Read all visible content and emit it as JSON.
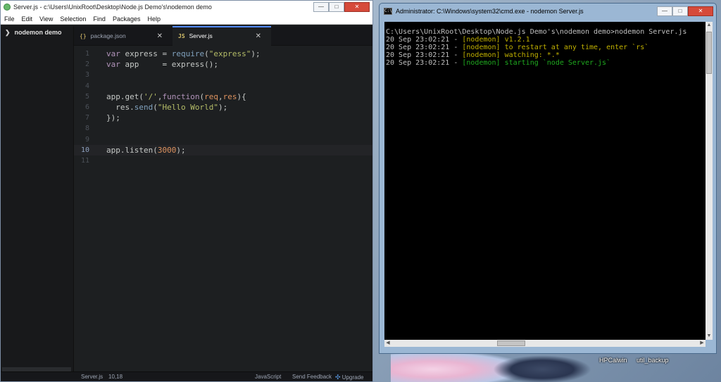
{
  "desktop": {
    "icons": [
      "HPCalwin",
      "util_backup"
    ]
  },
  "atom": {
    "title": "Server.js - c:\\Users\\UnixRoot\\Desktop\\Node.js Demo's\\nodemon demo",
    "window_buttons": {
      "minimize": "—",
      "maximize": "□",
      "close": "✕"
    },
    "menu": [
      "File",
      "Edit",
      "View",
      "Selection",
      "Find",
      "Packages",
      "Help"
    ],
    "tree_root": "nodemon demo",
    "tabs": [
      {
        "label": "package.json",
        "icon": "{}",
        "active": false
      },
      {
        "label": "Server.js",
        "icon": "JS",
        "active": true
      }
    ],
    "lines": [
      {
        "n": "1",
        "tokens": [
          [
            "kw",
            "var"
          ],
          [
            "par",
            " express "
          ],
          [
            "par",
            "= "
          ],
          [
            "fn",
            "require"
          ],
          [
            "par",
            "("
          ],
          [
            "str",
            "\"express\""
          ],
          [
            "par",
            ");"
          ]
        ]
      },
      {
        "n": "2",
        "tokens": [
          [
            "kw",
            "var"
          ],
          [
            "par",
            " app     "
          ],
          [
            "par",
            "= "
          ],
          [
            "par",
            "express();"
          ]
        ]
      },
      {
        "n": "3",
        "tokens": []
      },
      {
        "n": "4",
        "tokens": []
      },
      {
        "n": "5",
        "tokens": [
          [
            "par",
            "app.get("
          ],
          [
            "str",
            "'/'"
          ],
          [
            "par",
            ","
          ],
          [
            "kw",
            "function"
          ],
          [
            "par",
            "("
          ],
          [
            "num",
            "req"
          ],
          [
            "par",
            ","
          ],
          [
            "num",
            "res"
          ],
          [
            "par",
            "){"
          ]
        ]
      },
      {
        "n": "6",
        "tokens": [
          [
            "par",
            "  res."
          ],
          [
            "fn",
            "send"
          ],
          [
            "par",
            "("
          ],
          [
            "str",
            "\"Hello World\""
          ],
          [
            "par",
            ");"
          ]
        ]
      },
      {
        "n": "7",
        "tokens": [
          [
            "par",
            "});"
          ]
        ]
      },
      {
        "n": "8",
        "tokens": []
      },
      {
        "n": "9",
        "tokens": []
      },
      {
        "n": "10",
        "tokens": [
          [
            "par",
            "app.listen("
          ],
          [
            "num",
            "3000"
          ],
          [
            "par",
            ");"
          ]
        ],
        "cursor": true
      },
      {
        "n": "11",
        "tokens": []
      }
    ],
    "status": {
      "file": "Server.js",
      "position": "10,18",
      "grammar": "JavaScript",
      "feedback": "Send Feedback",
      "upgrade": "Upgrade"
    }
  },
  "cmd": {
    "title": "Administrator: C:\\Windows\\system32\\cmd.exe - nodemon  Server.js",
    "icon_text": "C:\\",
    "window_buttons": {
      "minimize": "—",
      "maximize": "□",
      "close": "✕"
    },
    "lines": [
      {
        "parts": [
          [
            "ts",
            "C:\\Users\\UnixRoot\\Desktop\\Node.js Demo's\\nodemon demo>nodemon Server.js"
          ]
        ]
      },
      {
        "parts": [
          [
            "ts",
            "20 Sep 23:02:21 - "
          ],
          [
            "yel",
            "[nodemon] v1.2.1"
          ]
        ]
      },
      {
        "parts": [
          [
            "ts",
            "20 Sep 23:02:21 - "
          ],
          [
            "yel",
            "[nodemon] to restart at any time, enter `rs`"
          ]
        ]
      },
      {
        "parts": [
          [
            "ts",
            "20 Sep 23:02:21 - "
          ],
          [
            "yel",
            "[nodemon] watching: *.*"
          ]
        ]
      },
      {
        "parts": [
          [
            "ts",
            "20 Sep 23:02:21 - "
          ],
          [
            "grn",
            "[nodemon] starting `node Server.js`"
          ]
        ]
      }
    ]
  }
}
